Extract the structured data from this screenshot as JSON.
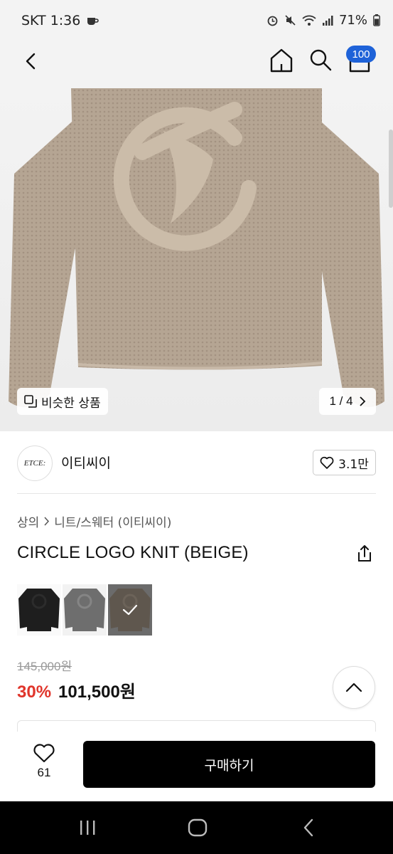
{
  "status_bar": {
    "carrier_time": "SKT 1:36",
    "battery": "71%"
  },
  "header": {
    "cart_count": "100"
  },
  "hero": {
    "similar_label": "비슷한 상품",
    "pager": "1 / 4"
  },
  "brand": {
    "logo_text": "ETCE:",
    "name": "이티씨이",
    "likes": "3.1만"
  },
  "breadcrumb": {
    "category": "상의",
    "subcategory": "니트/스웨터 (이티씨이)"
  },
  "product": {
    "title": "CIRCLE LOGO KNIT (BEIGE)",
    "original_price": "145,000원",
    "discount": "30%",
    "sale_price": "101,500원"
  },
  "swatches": [
    {
      "name": "black",
      "color": "#1e1e1e",
      "selected": false
    },
    {
      "name": "grey",
      "color": "#6e6e6e",
      "selected": false
    },
    {
      "name": "beige",
      "color": "#8a7a68",
      "selected": true
    }
  ],
  "action_bar": {
    "wish_count": "61",
    "buy_label": "구매하기"
  },
  "colors": {
    "accent_blue": "#1e62d8",
    "discount_red": "#e0352b",
    "sweater_beige": "#b7a795"
  }
}
